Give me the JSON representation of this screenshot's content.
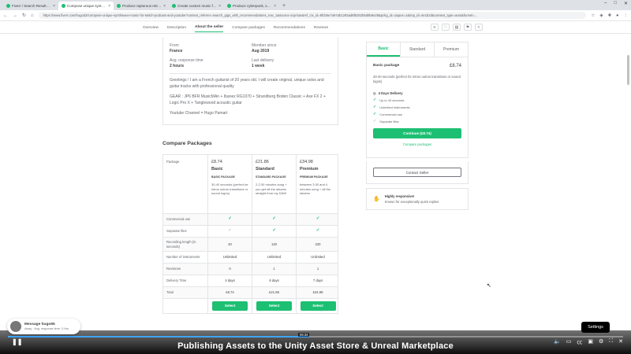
{
  "browser": {
    "tabs": [
      {
        "label": "Fiverr / Search Results for 'gui...",
        "active": false
      },
      {
        "label": "Compose unique synthwave m...",
        "active": true
      },
      {
        "label": "Produce rapturous retrowave...",
        "active": false
      },
      {
        "label": "Create custom music for your...",
        "active": false
      },
      {
        "label": "Produce cyberpunk, synthwave...",
        "active": false
      }
    ],
    "new_tab": "+",
    "url": "https://www.fiverr.com/hugod3/compose-unique-synthwave-music-for-twitch-podcast-and-youtube?context_referrer=search_gigs_with_recommendations_row_1&source=top-bar&ref_ctx_id=8fcb6e7a97ab1293ad8f5252b5d6b6e28&pckg_id=1&pos=1&imp_id=4e1b2d&context_type=auto&funnel=..."
  },
  "page_nav": {
    "links": [
      "Overview",
      "Description",
      "About the seller",
      "Compare packages",
      "Recommendations",
      "Reviews"
    ],
    "active": "About the seller"
  },
  "seller": {
    "from_label": "From",
    "from_value": "France",
    "member_label": "Member since",
    "member_value": "Aug 2019",
    "response_label": "Avg. response time",
    "response_value": "2 hours",
    "delivery_label": "Last delivery",
    "delivery_value": "1 week",
    "bio": "Greetings ! I am a French guitarist of 20 years old. I will create original, unique solos and guitar tracks with professional quality",
    "gear": "GEAR : JP6 BFR MusicMAn + Ibanez RG1070 + Strandberg Boden Classic + Axe FX 2 + Logic Pro X + Tanglewood acoustic guitar",
    "youtube": "Youtube Channel = Hugo Pamart"
  },
  "compare": {
    "title": "Compare Packages",
    "package_label": "Package",
    "packages": [
      {
        "price": "£8.74",
        "name": "Basic",
        "type": "BASIC PACKAGE",
        "desc": "30-40 seconds (perfect for intros outros transitions or sound logos)"
      },
      {
        "price": "£21.86",
        "name": "Standard",
        "type": "STANDARD PACKAGE",
        "desc": "2-2:30 minutes song + you get all the steams straight from my DAW"
      },
      {
        "price": "£34.98",
        "name": "Premium",
        "type": "PREMIUM PACKAGE",
        "desc": "between 3:30 and 4 minutes song + all the steams"
      }
    ],
    "rows": [
      {
        "label": "Commercial use",
        "values": [
          "check",
          "check",
          "check"
        ]
      },
      {
        "label": "Separate files",
        "values": [
          "nocheck",
          "check",
          "check"
        ]
      },
      {
        "label": "Recording length (in seconds)",
        "values": [
          "40",
          "120",
          "220"
        ]
      },
      {
        "label": "Number of instruments",
        "values": [
          "Unlimited",
          "Unlimited",
          "Unlimited"
        ]
      },
      {
        "label": "Revisions",
        "values": [
          "0",
          "1",
          "1"
        ]
      },
      {
        "label": "Delivery Time",
        "values": [
          "4 days",
          "6 days",
          "7 days"
        ]
      },
      {
        "label": "Total",
        "values": [
          "£8.74",
          "£21.86",
          "£34.98"
        ]
      }
    ],
    "select_label": "Select"
  },
  "sidebar": {
    "tabs": [
      "Basic",
      "Standard",
      "Premium"
    ],
    "active_tab": "Basic",
    "package_name": "Basic package",
    "price": "£8.74",
    "description": "30-40 seconds (perfect for intros outros transitions or sound logos)",
    "delivery": "4 Days Delivery",
    "features": [
      {
        "label": "Up to 40 seconds",
        "included": true
      },
      {
        "label": "Unlimited instruments",
        "included": true
      },
      {
        "label": "Commercial use",
        "included": true
      },
      {
        "label": "Separate files",
        "included": false
      }
    ],
    "continue_label": "Continue (£8.74)",
    "compare_link": "Compare packages",
    "contact_label": "Contact Seller",
    "highly_label": "Highly responsive!",
    "highly_sub": "Known for exceptionally quick replies"
  },
  "chat": {
    "title": "Message hugo65",
    "sub": "Away · Avg. response time: 3 Hrs"
  },
  "video": {
    "subtitle": "Publishing Assets to the Unity Asset Store & Unreal Marketplace",
    "time": "06:34",
    "progress": 0.49,
    "settings_label": "Settings"
  },
  "colors": {
    "accent": "#1dbf73",
    "text": "#404145",
    "muted": "#62646a"
  }
}
